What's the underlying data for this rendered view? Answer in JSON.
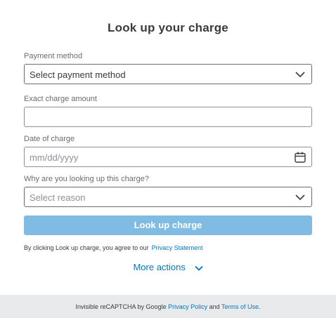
{
  "title": "Look up your charge",
  "payment_method": {
    "label": "Payment method",
    "value": "Select payment method"
  },
  "amount": {
    "label": "Exact charge amount",
    "value": ""
  },
  "date": {
    "label": "Date of charge",
    "placeholder": "mm/dd/yyyy"
  },
  "reason": {
    "label": "Why are you looking up this charge?",
    "placeholder": "Select reason"
  },
  "submit_label": "Look up charge",
  "consent": {
    "text": "By clicking Look up charge, you agree to our",
    "link": "Privacy Statement"
  },
  "more_actions": "More actions",
  "footer": {
    "prefix": "Invisible reCAPTCHA by Google ",
    "privacy": "Privacy Policy",
    "and": " and ",
    "terms": "Terms of Use",
    "suffix": "."
  },
  "colors": {
    "accent": "#0077c5",
    "button": "#7fbbe3",
    "footer_bg": "#e9eaec"
  },
  "icons": [
    "chevron-down-icon",
    "calendar-icon"
  ]
}
